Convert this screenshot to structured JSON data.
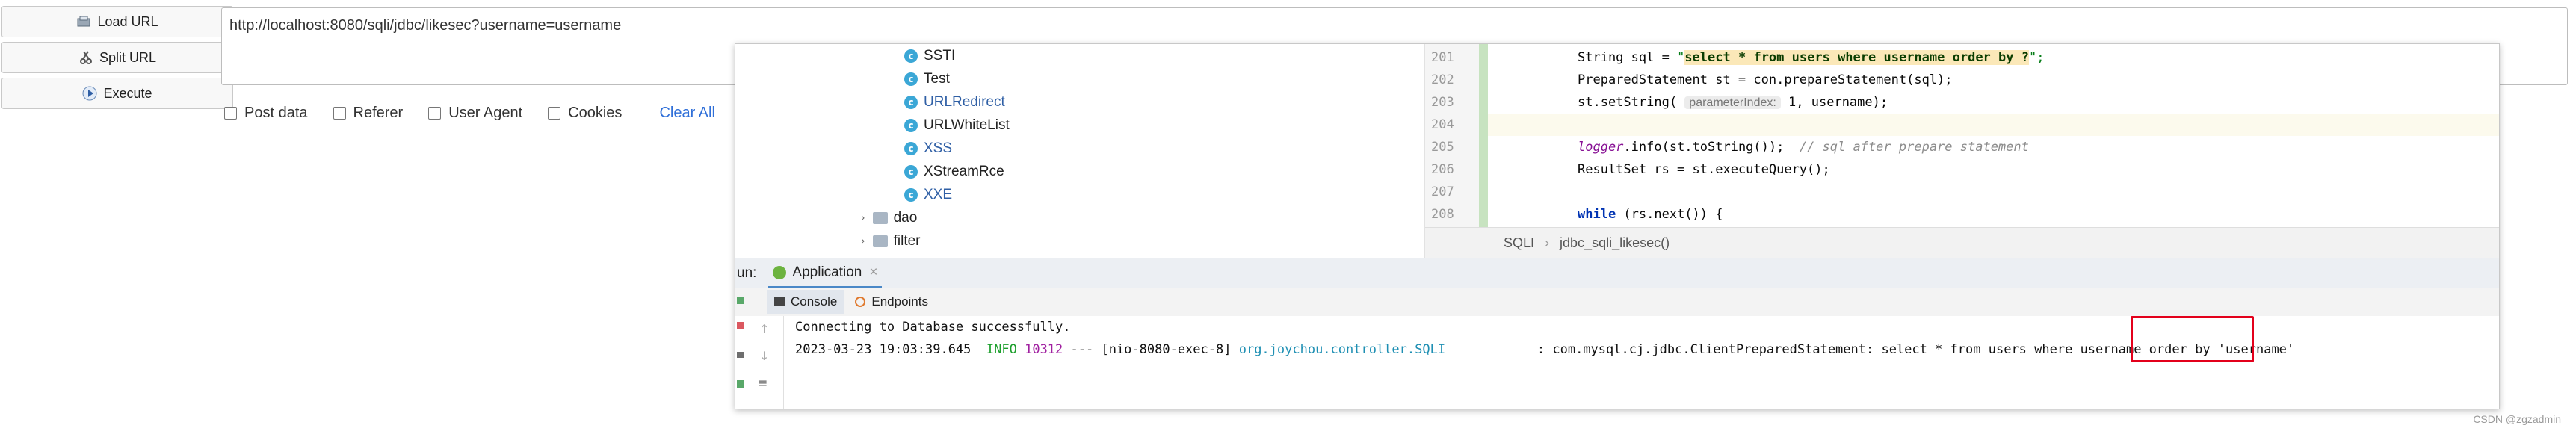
{
  "toolbar": {
    "load_url": "Load URL",
    "split_url": "Split URL",
    "execute": "Execute"
  },
  "url": {
    "value": "http://localhost:8080/sqli/jdbc/likesec?username=username"
  },
  "options": {
    "post_data": "Post data",
    "referer": "Referer",
    "user_agent": "User Agent",
    "cookies": "Cookies",
    "clear_all": "Clear All"
  },
  "project_tree": {
    "classes": [
      "SSTI",
      "Test",
      "URLRedirect",
      "URLWhiteList",
      "XSS",
      "XStreamRce",
      "XXE"
    ],
    "folders": [
      "dao",
      "filter"
    ]
  },
  "editor": {
    "line_numbers": [
      "201",
      "202",
      "203",
      "204",
      "205",
      "206",
      "207",
      "208"
    ],
    "l201_a": "String sql = ",
    "l201_q": "\"",
    "l201_s1": "select",
    "l201_s2": " * ",
    "l201_s3": "from",
    "l201_s4": " users ",
    "l201_s5": "where",
    "l201_s6": " username ",
    "l201_s7": "order by",
    "l201_s8": " ?",
    "l201_end": "\";",
    "l202": "PreparedStatement st = con.prepareStatement(sql);",
    "l203_a": "st.setString( ",
    "l203_hint": "parameterIndex:",
    "l203_b": " 1, username);",
    "l205_logger": "logger",
    "l205_a": ".info(st.toString());  ",
    "l205_cmt": "// sql after prepare statement",
    "l206": "ResultSet rs = st.executeQuery();",
    "l208_kw": "while",
    "l208_b": " (rs.next()) {",
    "breadcrumb": [
      "SQLI",
      "jdbc_sqli_likesec()"
    ]
  },
  "run": {
    "prefix": "un:",
    "tab": "Application",
    "close": "×",
    "tabs": [
      "Console",
      "Endpoints"
    ]
  },
  "console": {
    "line1": "Connecting to Database successfully.",
    "time": "2023-03-23 19:03:39.645",
    "level": "INFO",
    "pid": "10312",
    "sep": " --- ",
    "thread": "[nio-8080-exec-8]",
    "logger": "org.joychou.controller.SQLI",
    "message": ": com.mysql.cj.jdbc.ClientPreparedStatement: select * from users where username order by 'username'"
  },
  "watermark": "CSDN @zgzadmin",
  "colors": {
    "highlight_box": "#e3001b",
    "link": "#2f6fd8",
    "vcs_added": "#c7e3c0"
  }
}
